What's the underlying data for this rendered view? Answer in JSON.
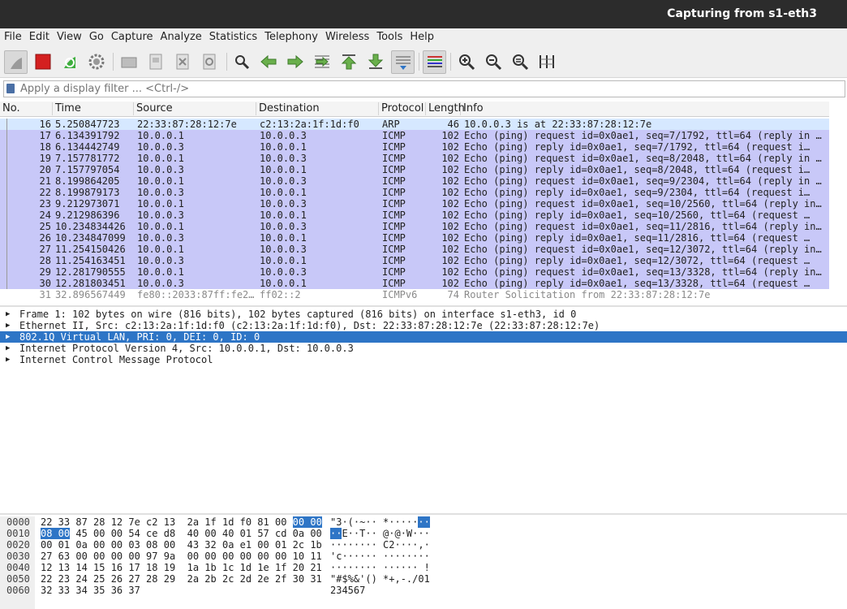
{
  "window": {
    "title": "Capturing from s1-eth3"
  },
  "menu": [
    "File",
    "Edit",
    "View",
    "Go",
    "Capture",
    "Analyze",
    "Statistics",
    "Telephony",
    "Wireless",
    "Tools",
    "Help"
  ],
  "toolbar": {
    "icons": [
      "shark-fin-icon",
      "stop-icon",
      "restart-icon",
      "options-gear-icon",
      "open-folder-icon",
      "save-file-icon",
      "close-file-icon",
      "reload-icon",
      "find-icon",
      "back-icon",
      "forward-icon",
      "goto-packet-icon",
      "first-packet-icon",
      "last-packet-icon",
      "autoscroll-icon",
      "colorize-icon",
      "zoom-in-icon",
      "zoom-out-icon",
      "zoom-reset-icon",
      "resize-columns-icon"
    ]
  },
  "filter": {
    "placeholder": "Apply a display filter ... <Ctrl-/>"
  },
  "packet_list": {
    "columns": [
      "No.",
      "Time",
      "Source",
      "Destination",
      "Protocol",
      "Length",
      "Info"
    ],
    "rows": [
      {
        "no": "16",
        "time": "5.250847723",
        "src": "22:33:87:28:12:7e",
        "dst": "c2:13:2a:1f:1d:f0",
        "proto": "ARP",
        "len": "46",
        "info": "10.0.0.3 is at 22:33:87:28:12:7e",
        "kind": "arp"
      },
      {
        "no": "17",
        "time": "6.134391792",
        "src": "10.0.0.1",
        "dst": "10.0.0.3",
        "proto": "ICMP",
        "len": "102",
        "info": "Echo (ping) request  id=0x0ae1, seq=7/1792, ttl=64 (reply in …",
        "kind": "icmp"
      },
      {
        "no": "18",
        "time": "6.134442749",
        "src": "10.0.0.3",
        "dst": "10.0.0.1",
        "proto": "ICMP",
        "len": "102",
        "info": "Echo (ping) reply    id=0x0ae1, seq=7/1792, ttl=64 (request i…",
        "kind": "icmp"
      },
      {
        "no": "19",
        "time": "7.157781772",
        "src": "10.0.0.1",
        "dst": "10.0.0.3",
        "proto": "ICMP",
        "len": "102",
        "info": "Echo (ping) request  id=0x0ae1, seq=8/2048, ttl=64 (reply in …",
        "kind": "icmp"
      },
      {
        "no": "20",
        "time": "7.157797054",
        "src": "10.0.0.3",
        "dst": "10.0.0.1",
        "proto": "ICMP",
        "len": "102",
        "info": "Echo (ping) reply    id=0x0ae1, seq=8/2048, ttl=64 (request i…",
        "kind": "icmp"
      },
      {
        "no": "21",
        "time": "8.199864205",
        "src": "10.0.0.1",
        "dst": "10.0.0.3",
        "proto": "ICMP",
        "len": "102",
        "info": "Echo (ping) request  id=0x0ae1, seq=9/2304, ttl=64 (reply in …",
        "kind": "icmp"
      },
      {
        "no": "22",
        "time": "8.199879173",
        "src": "10.0.0.3",
        "dst": "10.0.0.1",
        "proto": "ICMP",
        "len": "102",
        "info": "Echo (ping) reply    id=0x0ae1, seq=9/2304, ttl=64 (request i…",
        "kind": "icmp"
      },
      {
        "no": "23",
        "time": "9.212973071",
        "src": "10.0.0.1",
        "dst": "10.0.0.3",
        "proto": "ICMP",
        "len": "102",
        "info": "Echo (ping) request  id=0x0ae1, seq=10/2560, ttl=64 (reply in…",
        "kind": "icmp"
      },
      {
        "no": "24",
        "time": "9.212986396",
        "src": "10.0.0.3",
        "dst": "10.0.0.1",
        "proto": "ICMP",
        "len": "102",
        "info": "Echo (ping) reply    id=0x0ae1, seq=10/2560, ttl=64 (request …",
        "kind": "icmp"
      },
      {
        "no": "25",
        "time": "10.234834426",
        "src": "10.0.0.1",
        "dst": "10.0.0.3",
        "proto": "ICMP",
        "len": "102",
        "info": "Echo (ping) request  id=0x0ae1, seq=11/2816, ttl=64 (reply in…",
        "kind": "icmp"
      },
      {
        "no": "26",
        "time": "10.234847099",
        "src": "10.0.0.3",
        "dst": "10.0.0.1",
        "proto": "ICMP",
        "len": "102",
        "info": "Echo (ping) reply    id=0x0ae1, seq=11/2816, ttl=64 (request …",
        "kind": "icmp"
      },
      {
        "no": "27",
        "time": "11.254150426",
        "src": "10.0.0.1",
        "dst": "10.0.0.3",
        "proto": "ICMP",
        "len": "102",
        "info": "Echo (ping) request  id=0x0ae1, seq=12/3072, ttl=64 (reply in…",
        "kind": "icmp"
      },
      {
        "no": "28",
        "time": "11.254163451",
        "src": "10.0.0.3",
        "dst": "10.0.0.1",
        "proto": "ICMP",
        "len": "102",
        "info": "Echo (ping) reply    id=0x0ae1, seq=12/3072, ttl=64 (request …",
        "kind": "icmp"
      },
      {
        "no": "29",
        "time": "12.281790555",
        "src": "10.0.0.1",
        "dst": "10.0.0.3",
        "proto": "ICMP",
        "len": "102",
        "info": "Echo (ping) request  id=0x0ae1, seq=13/3328, ttl=64 (reply in…",
        "kind": "icmp"
      },
      {
        "no": "30",
        "time": "12.281803451",
        "src": "10.0.0.3",
        "dst": "10.0.0.1",
        "proto": "ICMP",
        "len": "102",
        "info": "Echo (ping) reply    id=0x0ae1, seq=13/3328, ttl=64 (request …",
        "kind": "icmp"
      },
      {
        "no": "31",
        "time": "32.896567449",
        "src": "fe80::2033:87ff:fe2…",
        "dst": "ff02::2",
        "proto": "ICMPv6",
        "len": "74",
        "info": "Router Solicitation from 22:33:87:28:12:7e",
        "kind": "grey"
      }
    ]
  },
  "details": [
    {
      "text": "Frame 1: 102 bytes on wire (816 bits), 102 bytes captured (816 bits) on interface s1-eth3, id 0",
      "selected": false
    },
    {
      "text": "Ethernet II, Src: c2:13:2a:1f:1d:f0 (c2:13:2a:1f:1d:f0), Dst: 22:33:87:28:12:7e (22:33:87:28:12:7e)",
      "selected": false
    },
    {
      "text": "802.1Q Virtual LAN, PRI: 0, DEI: 0, ID: 0",
      "selected": true
    },
    {
      "text": "Internet Protocol Version 4, Src: 10.0.0.1, Dst: 10.0.0.3",
      "selected": false
    },
    {
      "text": "Internet Control Message Protocol",
      "selected": false
    }
  ],
  "bytes": [
    {
      "offset": "0000",
      "pre": "22 33 87 28 12 7e c2 13  2a 1f 1d f0 81 00 ",
      "hl": "00 00",
      "post": "",
      "apre": "\"3·(·~·· *·····",
      "ahl": "··",
      "apost": ""
    },
    {
      "offset": "0010",
      "pre": "",
      "hl": "08 00",
      "post": " 45 00 00 54 ce d8  40 00 40 01 57 cd 0a 00",
      "apre": "",
      "ahl": "··",
      "apost": "E··T·· @·@·W···"
    },
    {
      "offset": "0020",
      "pre": "00 01 0a 00 00 03 08 00  43 32 0a e1 00 01 2c 1b",
      "hl": "",
      "post": "",
      "apre": "········ C2····,·",
      "ahl": "",
      "apost": ""
    },
    {
      "offset": "0030",
      "pre": "27 63 00 00 00 00 97 9a  00 00 00 00 00 00 10 11",
      "hl": "",
      "post": "",
      "apre": "'c······ ········",
      "ahl": "",
      "apost": ""
    },
    {
      "offset": "0040",
      "pre": "12 13 14 15 16 17 18 19  1a 1b 1c 1d 1e 1f 20 21",
      "hl": "",
      "post": "",
      "apre": "········ ······ !",
      "ahl": "",
      "apost": ""
    },
    {
      "offset": "0050",
      "pre": "22 23 24 25 26 27 28 29  2a 2b 2c 2d 2e 2f 30 31",
      "hl": "",
      "post": "",
      "apre": "\"#$%&'() *+,-./01",
      "ahl": "",
      "apost": ""
    },
    {
      "offset": "0060",
      "pre": "32 33 34 35 36 37",
      "hl": "",
      "post": "",
      "apre": "234567",
      "ahl": "",
      "apost": ""
    }
  ],
  "colors": {
    "arp": "#d6e8ff",
    "icmp": "#c8c8f8",
    "selected": "#2e75c6"
  }
}
